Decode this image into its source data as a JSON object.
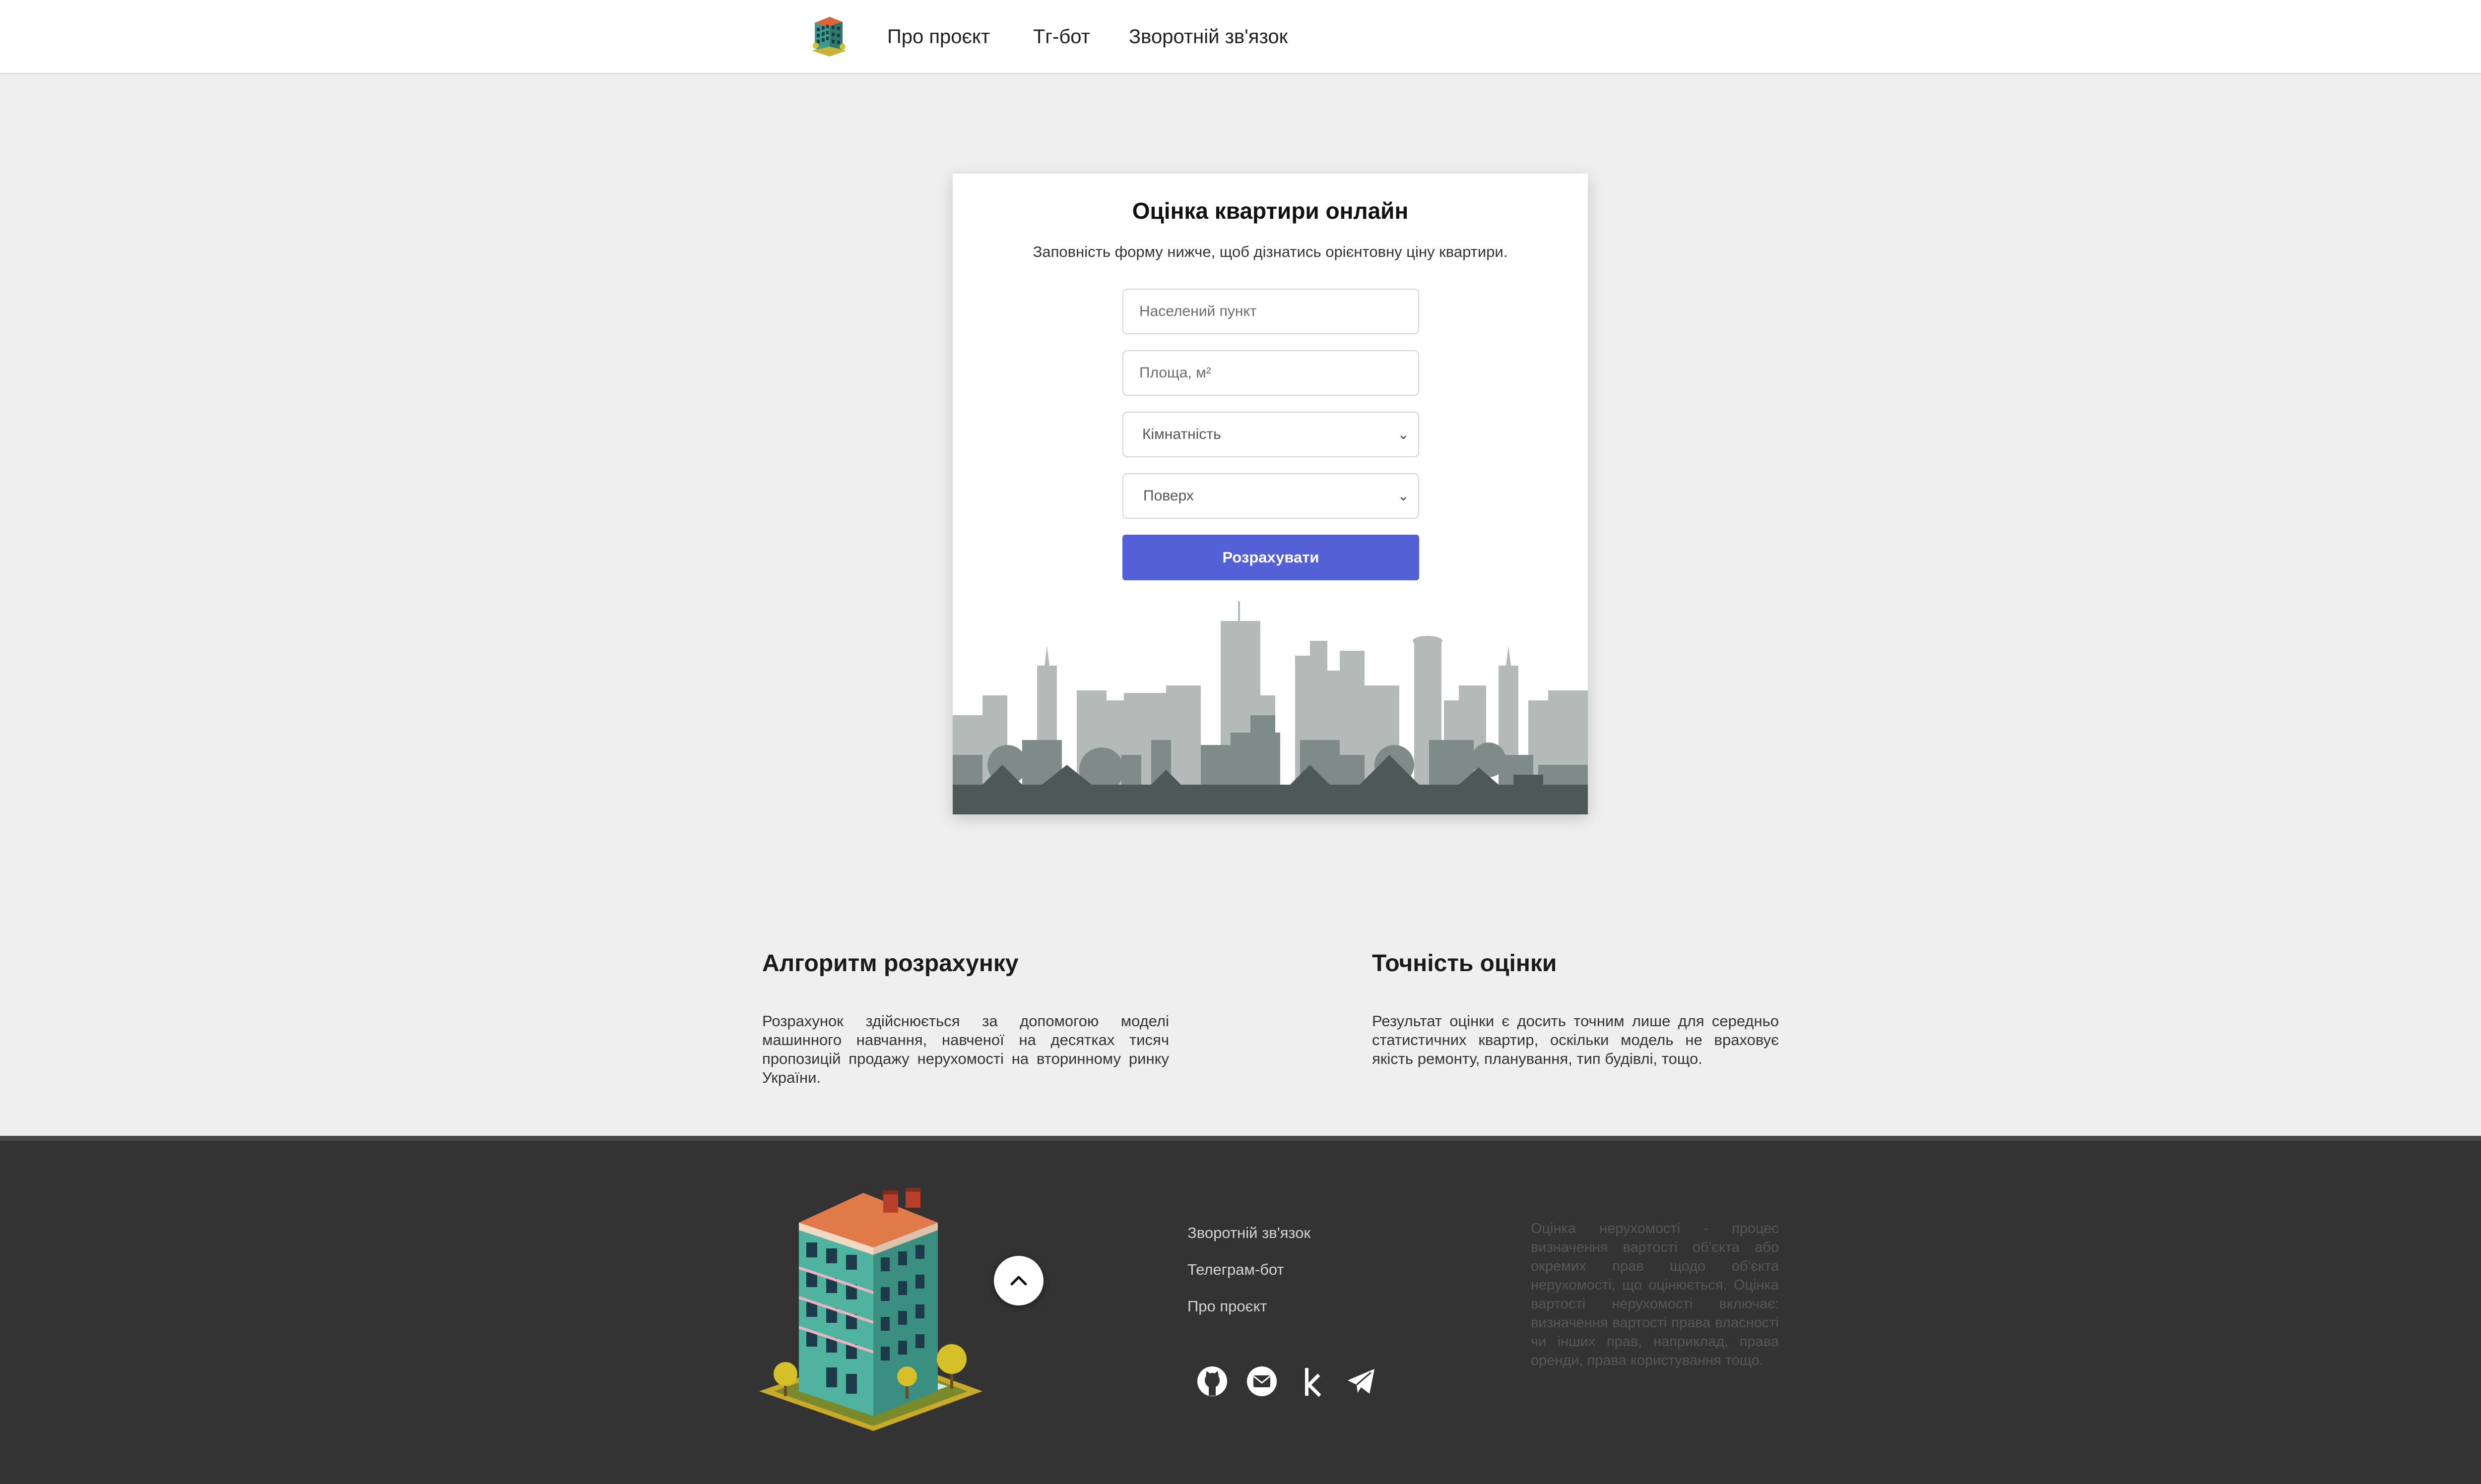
{
  "nav": {
    "logo_icon": "building-logo-icon",
    "links": [
      "Про проєкт",
      "Тг-бот",
      "Зворотній зв'язок"
    ]
  },
  "form": {
    "title": "Оцінка квартири онлайн",
    "subtitle": "Заповність форму нижче, щоб дізнатись орієнтовну ціну квартири.",
    "city_placeholder": "Населений пункт",
    "area_placeholder": "Площа, м²",
    "rooms_label": "Кімнатність",
    "floor_label": "Поверх",
    "submit_label": "Розрахувати",
    "accent_color": "#5461d6"
  },
  "info": {
    "algorithm": {
      "title": "Алгоритм розрахунку",
      "text": "Розрахунок здійснюється за допомогою моделі машинного навчання, навченої на десятках тисяч пропозицій продажу нерухомості на вторинному ринку України."
    },
    "accuracy": {
      "title": "Точність оцінки",
      "text": "Результат оцінки є досить точним лише для середньо статистичних квартир, оскільки модель не враховує якість ремонту, планування, тип будівлі, тощо."
    }
  },
  "footer": {
    "links": [
      "Зворотній зв'язок",
      "Телеграм-бот",
      "Про проєкт"
    ],
    "social_icons": [
      "github-icon",
      "email-icon",
      "kaggle-icon",
      "telegram-icon"
    ],
    "description": "Оцінка нерухомості - процес визначення вартості об'єкта або окремих прав щодо об'єкта нерухомості, що оцінюється. Оцінка вартості нерухомості включає: визначення вартості права власності чи інших прав, наприклад, права оренди, права користування тощо.",
    "background_color": "#333333"
  }
}
